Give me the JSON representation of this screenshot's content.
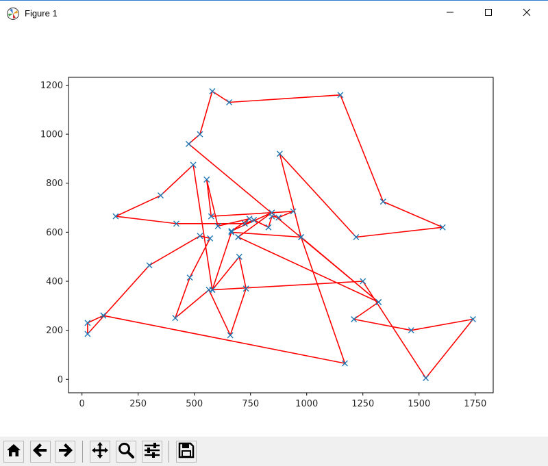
{
  "window": {
    "title": "Figure 1",
    "icons": {
      "app": "matplotlib-icon",
      "minimize": "minimize-icon",
      "maximize": "maximize-icon",
      "close": "close-icon"
    }
  },
  "toolbar": {
    "buttons": [
      {
        "name": "home-button",
        "icon": "home-icon"
      },
      {
        "name": "back-button",
        "icon": "arrow-left-icon"
      },
      {
        "name": "forward-button",
        "icon": "arrow-right-icon"
      },
      {
        "name": "pan-button",
        "icon": "move-icon"
      },
      {
        "name": "zoom-button",
        "icon": "magnifier-icon"
      },
      {
        "name": "configure-subplots-button",
        "icon": "sliders-icon"
      },
      {
        "name": "save-button",
        "icon": "floppy-disk-icon"
      }
    ]
  },
  "chart_data": {
    "type": "line",
    "title": "",
    "xlabel": "",
    "ylabel": "",
    "xlim": [
      -60,
      1830
    ],
    "ylim": [
      -55,
      1232
    ],
    "xticks": [
      0,
      250,
      500,
      750,
      1000,
      1250,
      1500,
      1750
    ],
    "yticks": [
      0,
      200,
      400,
      600,
      800,
      1000,
      1200
    ],
    "grid": false,
    "colors": {
      "route": "#ff0000",
      "marker": "#1f77b4"
    },
    "series": [
      {
        "marker": "x",
        "x": [
          95,
          25,
          25,
          300,
          525,
          570,
          480,
          415,
          565,
          660,
          730,
          700,
          580,
          495,
          350,
          150,
          420,
          725,
          765,
          830,
          845,
          875,
          940,
          575,
          555,
          605,
          745,
          665,
          845,
          695,
          1320,
          475,
          525,
          580,
          655,
          1150,
          1340,
          1605,
          1220,
          880,
          975,
          665,
          580,
          1250,
          1530,
          1740,
          1465,
          1210,
          1320,
          975,
          1170,
          95
        ],
        "y": [
          260,
          230,
          185,
          465,
          585,
          575,
          415,
          250,
          365,
          180,
          370,
          500,
          365,
          875,
          750,
          665,
          635,
          635,
          650,
          620,
          665,
          660,
          685,
          665,
          815,
          625,
          655,
          605,
          680,
          580,
          315,
          960,
          1000,
          1175,
          1130,
          1160,
          725,
          620,
          580,
          920,
          580,
          600,
          365,
          400,
          5,
          245,
          200,
          245,
          315,
          580,
          65,
          260
        ]
      }
    ]
  }
}
